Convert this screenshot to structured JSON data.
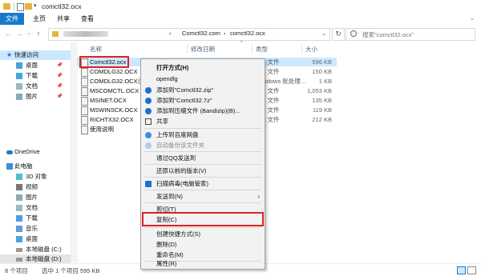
{
  "window": {
    "title": "comctl32.ocx",
    "colors": {
      "accent": "#1979ca",
      "selection": "#cce8ff",
      "highlight_box": "#d22222"
    }
  },
  "ribbon": {
    "tabs": [
      "文件",
      "主页",
      "共享",
      "查看"
    ]
  },
  "address": {
    "crumbs": [
      "Comctl32.com",
      "comctl32.ocx"
    ],
    "separator": "›",
    "search_placeholder": "搜索\"comctl32.ocx\""
  },
  "navpane": {
    "items": [
      {
        "label": "快速访问",
        "icon": "star-icon",
        "pinned": false
      },
      {
        "label": "桌面",
        "icon": "desktop-folder-icon",
        "pinned": true
      },
      {
        "label": "下载",
        "icon": "download-folder-icon",
        "pinned": true
      },
      {
        "label": "文档",
        "icon": "documents-folder-icon",
        "pinned": true
      },
      {
        "label": "图片",
        "icon": "pictures-folder-icon",
        "pinned": true
      },
      {
        "label": "OneDrive",
        "icon": "cloud-icon",
        "pinned": false
      },
      {
        "label": "此电脑",
        "icon": "computer-icon",
        "pinned": false
      },
      {
        "label": "3D 对象",
        "icon": "3d-objects-icon",
        "pinned": false
      },
      {
        "label": "视频",
        "icon": "videos-folder-icon",
        "pinned": false
      },
      {
        "label": "图片",
        "icon": "pictures-folder-icon",
        "pinned": false
      },
      {
        "label": "文档",
        "icon": "documents-folder-icon",
        "pinned": false
      },
      {
        "label": "下载",
        "icon": "download-folder-icon",
        "pinned": false
      },
      {
        "label": "音乐",
        "icon": "music-folder-icon",
        "pinned": false
      },
      {
        "label": "桌面",
        "icon": "desktop-folder-icon",
        "pinned": false
      },
      {
        "label": "本地磁盘 (C:)",
        "icon": "drive-icon",
        "pinned": false
      },
      {
        "label": "本地磁盘 (D:)",
        "icon": "drive-icon",
        "pinned": false
      }
    ]
  },
  "columns": {
    "name": "名称",
    "date": "修改日期",
    "type": "类型",
    "size": "大小"
  },
  "files": [
    {
      "name": "Comctl32.ocx",
      "type": "CX 文件",
      "size": "596 KB",
      "selected": true
    },
    {
      "name": "COMDLG32.OCX",
      "type": "CX 文件",
      "size": "150 KB",
      "selected": false
    },
    {
      "name": "COMDLG32.OCX注册",
      "type": "Vindows 批处理...",
      "size": "1 KB",
      "selected": false
    },
    {
      "name": "MSCOMCTL.OCX",
      "type": "CX 文件",
      "size": "1,053 KB",
      "selected": false
    },
    {
      "name": "MSINET.OCX",
      "type": "CX 文件",
      "size": "135 KB",
      "selected": false
    },
    {
      "name": "MSWINSCK.OCX",
      "type": "CX 文件",
      "size": "119 KB",
      "selected": false
    },
    {
      "name": "RICHTX32.OCX",
      "type": "CX 文件",
      "size": "212 KB",
      "selected": false
    },
    {
      "name": "使用说明",
      "type": "",
      "size": "",
      "selected": false
    }
  ],
  "status": {
    "count": "8 个项目",
    "selection": "选中 1 个项目  595 KB"
  },
  "context_menu": {
    "items": [
      {
        "label": "打开方式(H)",
        "bold": true,
        "icon": ""
      },
      {
        "label": "opendlg",
        "icon": ""
      },
      {
        "label": "添加到\"Comctl32.zip\"",
        "icon": "bandizip-icon"
      },
      {
        "label": "添加到\"Comctl32.7z\"",
        "icon": "bandizip-icon"
      },
      {
        "label": "添加到压缩文件 (Bandizip)(B)...",
        "icon": "bandizip-icon"
      },
      {
        "label": "共享",
        "icon": "share-icon"
      },
      {
        "label": "上传到百度网盘",
        "icon": "baidu-cloud-icon"
      },
      {
        "label": "自动备份该文件夹",
        "icon": "baidu-cloud-icon",
        "disabled": true
      },
      {
        "label": "通过QQ发送到",
        "icon": ""
      },
      {
        "label": "还原以前的版本(V)",
        "icon": ""
      },
      {
        "label": "扫描病毒(电脑管家)",
        "icon": "shield-icon"
      },
      {
        "label": "发送到(N)",
        "icon": "",
        "submenu": true
      },
      {
        "label": "剪切(T)",
        "icon": ""
      },
      {
        "label": "复制(C)",
        "icon": "",
        "highlighted": true
      },
      {
        "label": "创建快捷方式(S)",
        "icon": ""
      },
      {
        "label": "删除(D)",
        "icon": ""
      },
      {
        "label": "重命名(M)",
        "icon": ""
      },
      {
        "label": "属性(R)",
        "icon": ""
      }
    ]
  }
}
